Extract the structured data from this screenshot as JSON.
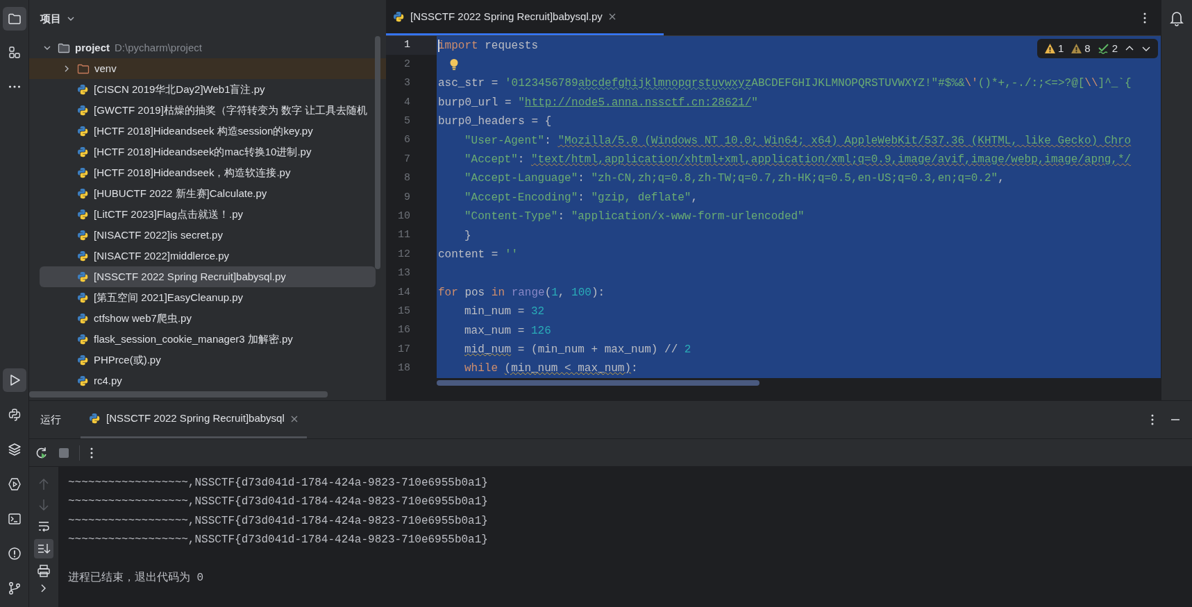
{
  "tool_strip": {
    "top": [
      {
        "kind": "project",
        "selected": true
      },
      {
        "kind": "structure",
        "selected": false
      },
      {
        "kind": "more",
        "selected": false
      }
    ],
    "bottom": [
      {
        "kind": "run",
        "selected": true
      },
      {
        "kind": "python",
        "selected": false
      },
      {
        "kind": "layers",
        "selected": false
      },
      {
        "kind": "services",
        "selected": false
      },
      {
        "kind": "terminal",
        "selected": false
      },
      {
        "kind": "problems",
        "selected": false
      },
      {
        "kind": "git",
        "selected": false
      }
    ]
  },
  "project_panel": {
    "title": "项目",
    "tree": [
      {
        "label": "project",
        "path": "D:\\pycharm\\project",
        "kind": "folder",
        "expanded": true,
        "selected": false,
        "excluded": false,
        "children": [
          {
            "label": "venv",
            "kind": "folder",
            "expanded": false,
            "selected": false,
            "excluded": true
          },
          {
            "label": "[CISCN 2019华北Day2]Web1盲注.py",
            "kind": "python",
            "selected": false
          },
          {
            "label": "[GWCTF 2019]枯燥的抽奖（字符转变为 数字 让工具去随机",
            "kind": "python",
            "selected": false
          },
          {
            "label": "[HCTF 2018]Hideandseek 构造session的key.py",
            "kind": "python",
            "selected": false
          },
          {
            "label": "[HCTF 2018]Hideandseek的mac转换10进制.py",
            "kind": "python",
            "selected": false
          },
          {
            "label": "[HCTF 2018]Hideandseek，构造软连接.py",
            "kind": "python",
            "selected": false
          },
          {
            "label": "[HUBUCTF 2022 新生赛]Calculate.py",
            "kind": "python",
            "selected": false
          },
          {
            "label": "[LitCTF 2023]Flag点击就送！.py",
            "kind": "python",
            "selected": false
          },
          {
            "label": "[NISACTF 2022]is secret.py",
            "kind": "python",
            "selected": false
          },
          {
            "label": "[NISACTF 2022]middlerce.py",
            "kind": "python",
            "selected": false
          },
          {
            "label": "[NSSCTF 2022 Spring Recruit]babysql.py",
            "kind": "python",
            "selected": true
          },
          {
            "label": "[第五空间 2021]EasyCleanup.py",
            "kind": "python",
            "selected": false
          },
          {
            "label": "ctfshow web7爬虫.py",
            "kind": "python",
            "selected": false
          },
          {
            "label": "flask_session_cookie_manager3 加解密.py",
            "kind": "python",
            "selected": false
          },
          {
            "label": "PHPrce(或).py",
            "kind": "python",
            "selected": false
          },
          {
            "label": "rc4.py",
            "kind": "python",
            "selected": false
          }
        ]
      }
    ]
  },
  "editor": {
    "tabs": [
      {
        "label": "[NSSCTF 2022 Spring Recruit]babysql.py",
        "selected": true
      }
    ],
    "inspections": [
      {
        "kind": "error",
        "count": "1"
      },
      {
        "kind": "warning",
        "count": "8"
      },
      {
        "kind": "typo",
        "count": "2"
      }
    ],
    "lines": [
      {
        "number": "1",
        "current": true,
        "bulb": false,
        "indented": false,
        "tokens": [
          {
            "kind": "keyword",
            "text": "import"
          },
          {
            "kind": "plain",
            "text": " requests"
          }
        ]
      },
      {
        "number": "2",
        "current": false,
        "bulb": true
      },
      {
        "number": "3",
        "current": false,
        "bulb": false,
        "indented": false,
        "tokens": [
          {
            "kind": "plain",
            "text": "asc_str = "
          },
          {
            "kind": "string",
            "text": "'0123456789"
          },
          {
            "kind": "typo",
            "text": "abcdefghijklmnopqrstuvwxyz"
          },
          {
            "kind": "string",
            "text": "ABCDEFGHIJKLMNOPQRSTUVWXYZ!\"#$%&"
          },
          {
            "kind": "escape",
            "text": "\\'"
          },
          {
            "kind": "string",
            "text": "()*+,-./:;<=>?@["
          },
          {
            "kind": "escape",
            "text": "\\\\"
          },
          {
            "kind": "string",
            "text": "]^_`{"
          }
        ]
      },
      {
        "number": "4",
        "current": false,
        "bulb": false,
        "indented": false,
        "tokens": [
          {
            "kind": "plain",
            "text": "burp0_url = "
          },
          {
            "kind": "string",
            "text": "\""
          },
          {
            "kind": "link",
            "text": "http://node5.anna.nssctf.cn:28621/"
          },
          {
            "kind": "string",
            "text": "\""
          }
        ]
      },
      {
        "number": "5",
        "current": false,
        "bulb": false,
        "indented": false,
        "tokens": [
          {
            "kind": "plain",
            "text": "burp0_headers = {"
          }
        ]
      },
      {
        "number": "6",
        "current": false,
        "bulb": false,
        "indented": true,
        "tokens": [
          {
            "kind": "string",
            "text": "\"User-Agent\""
          },
          {
            "kind": "plain",
            "text": ": "
          },
          {
            "kind": "warn_string",
            "text": "\"Mozilla/5.0 (Windows NT 10.0; Win64; x64) AppleWebKit/537.36 (KHTML, like Gecko) Chro"
          }
        ]
      },
      {
        "number": "7",
        "current": false,
        "bulb": false,
        "indented": true,
        "tokens": [
          {
            "kind": "string",
            "text": "\"Accept\""
          },
          {
            "kind": "plain",
            "text": ": "
          },
          {
            "kind": "warn_string",
            "text": "\"text/html,application/xhtml+xml,application/xml;q=0.9,image/avif,image/webp,image/apng,*/"
          }
        ]
      },
      {
        "number": "8",
        "current": false,
        "bulb": false,
        "indented": true,
        "tokens": [
          {
            "kind": "string",
            "text": "\"Accept-Language\""
          },
          {
            "kind": "plain",
            "text": ": "
          },
          {
            "kind": "string",
            "text": "\"zh-CN,zh;q=0.8,zh-TW;q=0.7,zh-HK;q=0.5,en-US;q=0.3,en;q=0.2\""
          },
          {
            "kind": "plain",
            "text": ","
          }
        ]
      },
      {
        "number": "9",
        "current": false,
        "bulb": false,
        "indented": true,
        "tokens": [
          {
            "kind": "string",
            "text": "\"Accept-Encoding\""
          },
          {
            "kind": "plain",
            "text": ": "
          },
          {
            "kind": "string",
            "text": "\"gzip, deflate\""
          },
          {
            "kind": "plain",
            "text": ","
          }
        ]
      },
      {
        "number": "10",
        "current": false,
        "bulb": false,
        "indented": true,
        "tokens": [
          {
            "kind": "string",
            "text": "\"Content-Type\""
          },
          {
            "kind": "plain",
            "text": ": "
          },
          {
            "kind": "string",
            "text": "\"application/x-www-form-urlencoded\""
          }
        ]
      },
      {
        "number": "11",
        "current": false,
        "bulb": false,
        "indented": true,
        "tokens": [
          {
            "kind": "plain",
            "text": "}"
          }
        ]
      },
      {
        "number": "12",
        "current": false,
        "bulb": false,
        "indented": false,
        "tokens": [
          {
            "kind": "plain",
            "text": "content = "
          },
          {
            "kind": "string",
            "text": "''"
          }
        ]
      },
      {
        "number": "13",
        "current": false,
        "bulb": false
      },
      {
        "number": "14",
        "current": false,
        "bulb": false,
        "indented": false,
        "tokens": [
          {
            "kind": "keyword",
            "text": "for"
          },
          {
            "kind": "plain",
            "text": " pos "
          },
          {
            "kind": "keyword",
            "text": "in"
          },
          {
            "kind": "builtin",
            "text": " range"
          },
          {
            "kind": "plain",
            "text": "("
          },
          {
            "kind": "number",
            "text": "1"
          },
          {
            "kind": "plain",
            "text": ", "
          },
          {
            "kind": "number",
            "text": "100"
          },
          {
            "kind": "plain",
            "text": "):"
          }
        ]
      },
      {
        "number": "15",
        "current": false,
        "bulb": false,
        "indented": true,
        "tokens": [
          {
            "kind": "plain",
            "text": "min_num = "
          },
          {
            "kind": "number",
            "text": "32"
          }
        ]
      },
      {
        "number": "16",
        "current": false,
        "bulb": false,
        "indented": true,
        "tokens": [
          {
            "kind": "plain",
            "text": "max_num = "
          },
          {
            "kind": "number",
            "text": "126"
          }
        ]
      },
      {
        "number": "17",
        "current": false,
        "bulb": false,
        "indented": true,
        "tokens": [
          {
            "kind": "warn_plain",
            "text": "mid_num"
          },
          {
            "kind": "plain",
            "text": " = (min_num + max_num) // "
          },
          {
            "kind": "number",
            "text": "2"
          }
        ]
      },
      {
        "number": "18",
        "current": false,
        "bulb": false,
        "indented": true,
        "tokens": [
          {
            "kind": "keyword",
            "text": "while "
          },
          {
            "kind": "warn_plain",
            "text": "(min_num < max_num)"
          },
          {
            "kind": "plain",
            "text": ":"
          }
        ]
      }
    ]
  },
  "run_panel": {
    "title": "运行",
    "tabs": [
      {
        "label": "[NSSCTF 2022 Spring Recruit]babysql",
        "selected": true
      }
    ],
    "output": [
      "~~~~~~~~~~~~~~~~~~,NSSCTF{d73d041d-1784-424a-9823-710e6955b0a1}",
      "~~~~~~~~~~~~~~~~~~,NSSCTF{d73d041d-1784-424a-9823-710e6955b0a1}",
      "~~~~~~~~~~~~~~~~~~,NSSCTF{d73d041d-1784-424a-9823-710e6955b0a1}",
      "~~~~~~~~~~~~~~~~~~,NSSCTF{d73d041d-1784-424a-9823-710e6955b0a1}"
    ],
    "exit_message": "进程已结束，退出代码为 0"
  }
}
